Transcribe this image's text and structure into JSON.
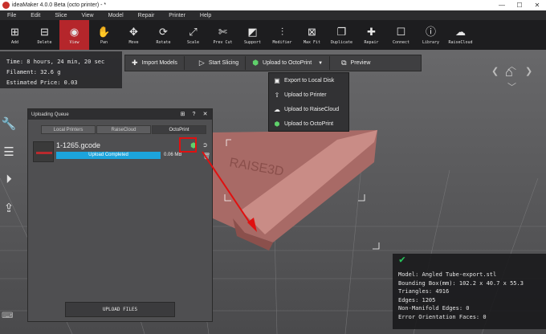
{
  "titlebar": {
    "title": "ideaMaker 4.0.0 Beta (octo printer) - *",
    "min": "—",
    "max": "☐",
    "close": "✕"
  },
  "menu": [
    "File",
    "Edit",
    "Slice",
    "View",
    "Model",
    "Repair",
    "Printer",
    "Help"
  ],
  "toolbar": [
    {
      "label": "Add",
      "icon": "⊞"
    },
    {
      "label": "Delete",
      "icon": "⊟"
    },
    {
      "label": "View",
      "icon": "◉"
    },
    {
      "label": "Pan",
      "icon": "✋"
    },
    {
      "label": "Move",
      "icon": "✥"
    },
    {
      "label": "Rotate",
      "icon": "⟳"
    },
    {
      "label": "Scale",
      "icon": "⤢"
    },
    {
      "label": "Prev Cut",
      "icon": "✄"
    },
    {
      "label": "Support",
      "icon": "◩"
    },
    {
      "label": "Modifier",
      "icon": "⫶"
    },
    {
      "label": "Max Fit",
      "icon": "⊠"
    },
    {
      "label": "Duplicate",
      "icon": "❐"
    },
    {
      "label": "Repair",
      "icon": "✚"
    },
    {
      "label": "Connect",
      "icon": "☐"
    },
    {
      "label": "Library",
      "icon": "ⓘ"
    },
    {
      "label": "RaiseCloud",
      "icon": "☁"
    }
  ],
  "info": {
    "time": "Time: 8 hours, 24 min, 20 sec",
    "filament": "Filament: 32.6 g",
    "price": "Estimated Price: 0.03"
  },
  "actionbar": {
    "import": "Import Models",
    "slice": "Start Slicing",
    "upload": "Upload to OctoPrint",
    "preview": "Preview"
  },
  "dropdown": [
    {
      "label": "Export to Local Disk",
      "icon": "▣"
    },
    {
      "label": "Upload to Printer",
      "icon": "⇧"
    },
    {
      "label": "Upload to RaiseCloud",
      "icon": "☁"
    },
    {
      "label": "Upload to OctoPrint",
      "icon": "⬢"
    }
  ],
  "panel": {
    "title": "Uploading Queue",
    "tabs": [
      "Local Printers",
      "RaiseCloud",
      "OctoPrint"
    ],
    "file": "1-1265.gcode",
    "status": "Upload Completed",
    "size": "0.06 MB",
    "upload_btn": "UPLOAD FILES"
  },
  "model": {
    "name": "Model: Angled Tube-export.stl",
    "bbox": "Bounding Box(mm): 102.2 x 40.7 x 55.3",
    "triangles": "Triangles: 4916",
    "edges": "Edges: 1205",
    "nonmanifold": "Non-Manifold Edges: 0",
    "orientation": "Error Orientation Faces: 0"
  },
  "colors": {
    "accent": "#b5262b",
    "progress": "#1ca4dc",
    "octoprint": "#5fd16b",
    "highlight": "#e01010"
  }
}
